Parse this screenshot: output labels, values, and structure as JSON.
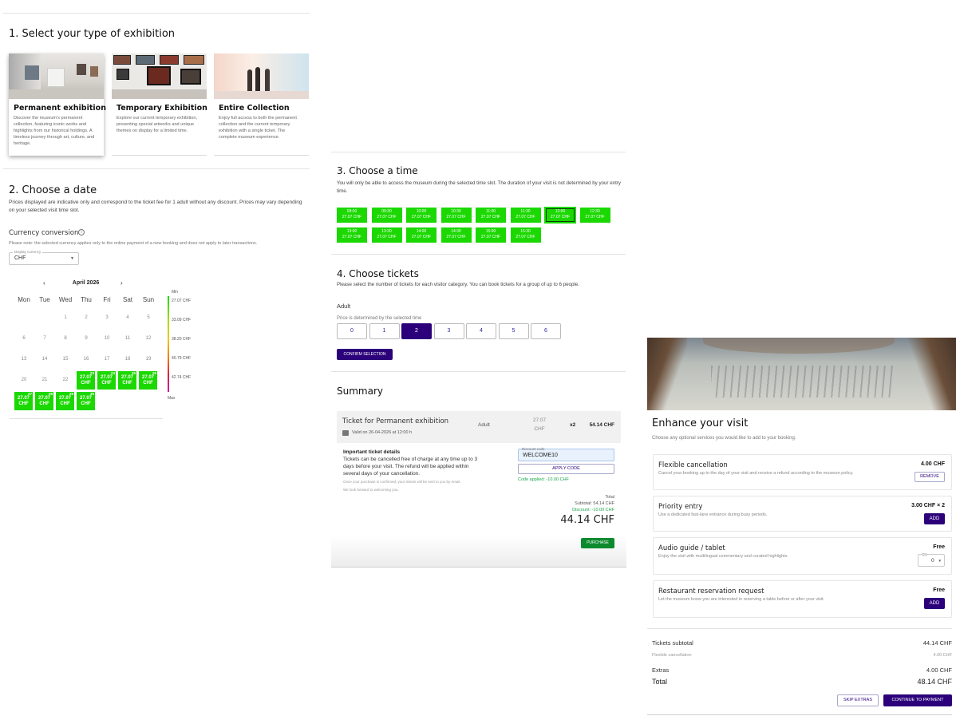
{
  "section1": {
    "title": "1. Select your type of exhibition",
    "cards": [
      {
        "title": "Permanent exhibition",
        "desc": "Discover the museum's permanent collection, featuring iconic works and highlights from our historical holdings. A timeless journey through art, culture, and heritage."
      },
      {
        "title": "Temporary Exhibition",
        "desc": "Explore our current temporary exhibition, presenting special artworks and unique themes on display for a limited time."
      },
      {
        "title": "Entire Collection",
        "desc": "Enjoy full access to both the permanent collection and the current temporary exhibition with a single ticket. The complete museum experience."
      }
    ]
  },
  "section2": {
    "title": "2. Choose a date",
    "desc": "Prices displayed are indicative only and correspond to the ticket fee for 1 adult without any discount. Prices may vary depending on your selected visit time slot.",
    "currency_title": "Currency conversion",
    "currency_icon": "info-icon",
    "currency_note": "Please note: the selected currency applies only to the online payment of a new booking and does not apply to later transactions.",
    "currency_label": "Display currency",
    "currency_value": "CHF",
    "month": "April 2026",
    "weekdays": [
      "Mon",
      "Tue",
      "Wed",
      "Thu",
      "Fri",
      "Sat",
      "Sun"
    ],
    "days": [
      [
        "",
        "",
        "1",
        "2",
        "3",
        "4",
        "5"
      ],
      [
        "6",
        "7",
        "8",
        "9",
        "10",
        "11",
        "12"
      ],
      [
        "13",
        "14",
        "15",
        "16",
        "17",
        "18",
        "19"
      ],
      [
        "20",
        "21",
        "22"
      ]
    ],
    "priced_days": [
      {
        "day": "23",
        "price": "27.07",
        "cur": "CHF"
      },
      {
        "day": "24",
        "price": "27.07",
        "cur": "CHF"
      },
      {
        "day": "25",
        "price": "27.07",
        "cur": "CHF"
      },
      {
        "day": "26",
        "price": "27.07",
        "cur": "CHF"
      },
      {
        "day": "27",
        "price": "27.07",
        "cur": "CHF"
      },
      {
        "day": "28",
        "price": "27.07",
        "cur": "CHF"
      },
      {
        "day": "29",
        "price": "27.07",
        "cur": "CHF"
      },
      {
        "day": "30",
        "price": "27.07",
        "cur": "CHF"
      }
    ],
    "legend": {
      "min": "Min",
      "max": "Max",
      "levels": [
        "27.07 CHF",
        "33.09 CHF",
        "38.20 CHF",
        "40.79 CHF",
        "42.74 CHF"
      ]
    },
    "colors": {
      "available": "#1ad800"
    }
  },
  "section3": {
    "title": "3. Choose a time",
    "desc": "You will only be able to access the museum during the selected time slot. The duration of your visit is not determined by your entry time.",
    "slots": [
      {
        "time": "09:00",
        "price": "27.07 CHF"
      },
      {
        "time": "09:30",
        "price": "27.07 CHF"
      },
      {
        "time": "10:00",
        "price": "27.07 CHF"
      },
      {
        "time": "10:30",
        "price": "27.07 CHF"
      },
      {
        "time": "11:00",
        "price": "27.07 CHF"
      },
      {
        "time": "11:30",
        "price": "27.07 CHF"
      },
      {
        "time": "12:00",
        "price": "27.07 CHF"
      },
      {
        "time": "12:30",
        "price": "27.07 CHF"
      },
      {
        "time": "13:00",
        "price": "27.07 CHF"
      },
      {
        "time": "13:30",
        "price": "27.07 CHF"
      },
      {
        "time": "14:00",
        "price": "27.07 CHF"
      },
      {
        "time": "14:30",
        "price": "27.07 CHF"
      },
      {
        "time": "15:00",
        "price": "27.07 CHF"
      },
      {
        "time": "15:30",
        "price": "27.07 CHF"
      }
    ],
    "selected": "12:00"
  },
  "section4": {
    "title": "4. Choose tickets",
    "desc": "Please select the number of tickets for each visitor category. You can book tickets for a group of up to 6 people.",
    "category": "Adult",
    "note": "Price is determined by the selected time",
    "counts": [
      "0",
      "1",
      "2",
      "3",
      "4",
      "5",
      "6"
    ],
    "selected": "2",
    "confirm": "CONFIRM SELECTION"
  },
  "summary": {
    "title": "Summary",
    "ticket_title": "Ticket for Permanent exhibition",
    "valid": "Valid on 26-04-2026 at 12:00 h",
    "category": "Adult",
    "unit_price": "27.07",
    "unit_cur": "CHF",
    "qty": "x2",
    "line_total": "54.14 CHF",
    "details_title": "Important ticket details",
    "details": "Tickets can be cancelled free of charge at any time up to 3 days before your visit. The refund will be applied within several days of your cancellation.",
    "email_note": "Once your purchase is confirmed, your tickets will be sent to you by email.",
    "welcome_note": "We look forward to welcoming you.",
    "discount_label": "Discount code",
    "discount_value": "WELCOME10",
    "apply": "APPLY CODE",
    "applied": "Code applied: -10.00 CHF",
    "total_label": "Total",
    "subtotal": "Subtotal: 54.14 CHF",
    "discount": "Discount: -10.00 CHF",
    "total": "44.14 CHF",
    "purchase": "PURCHASE",
    "colors": {
      "purchase": "#0c8a2e",
      "applied": "#1aa64a"
    }
  },
  "extras": {
    "title": "Enhance your visit",
    "desc": "Choose any optional services you would like to add to your booking.",
    "services": [
      {
        "title": "Flexible cancellation",
        "desc": "Cancel your booking up to the day of your visit and receive a refund according to the museum policy.",
        "price": "4.00 CHF",
        "action": "REMOVE"
      },
      {
        "title": "Priority entry",
        "desc": "Use a dedicated fast-lane entrance during busy periods.",
        "price": "3.00 CHF × 2",
        "action": "ADD"
      },
      {
        "title": "Audio guide / tablet",
        "desc": "Enjoy the visit with multilingual commentary and curated highlights.",
        "price": "Free",
        "qty_label": "Qty",
        "qty": "0"
      },
      {
        "title": "Restaurant reservation request",
        "desc": "Let the museum know you are interested in reserving a table before or after your visit.",
        "price": "Free",
        "action": "ADD"
      }
    ],
    "totals": [
      {
        "label": "Tickets subtotal",
        "value": "44.14 CHF"
      },
      {
        "label": "Flexible cancellation",
        "value": "4.00 CHF"
      },
      {
        "label": "Extras",
        "value": "4.00 CHF"
      },
      {
        "label": "Total",
        "value": "48.14 CHF"
      }
    ],
    "skip": "SKIP EXTRAS",
    "continue": "CONTINUE TO PAYMENT",
    "colors": {
      "primary": "#2b007a"
    }
  }
}
